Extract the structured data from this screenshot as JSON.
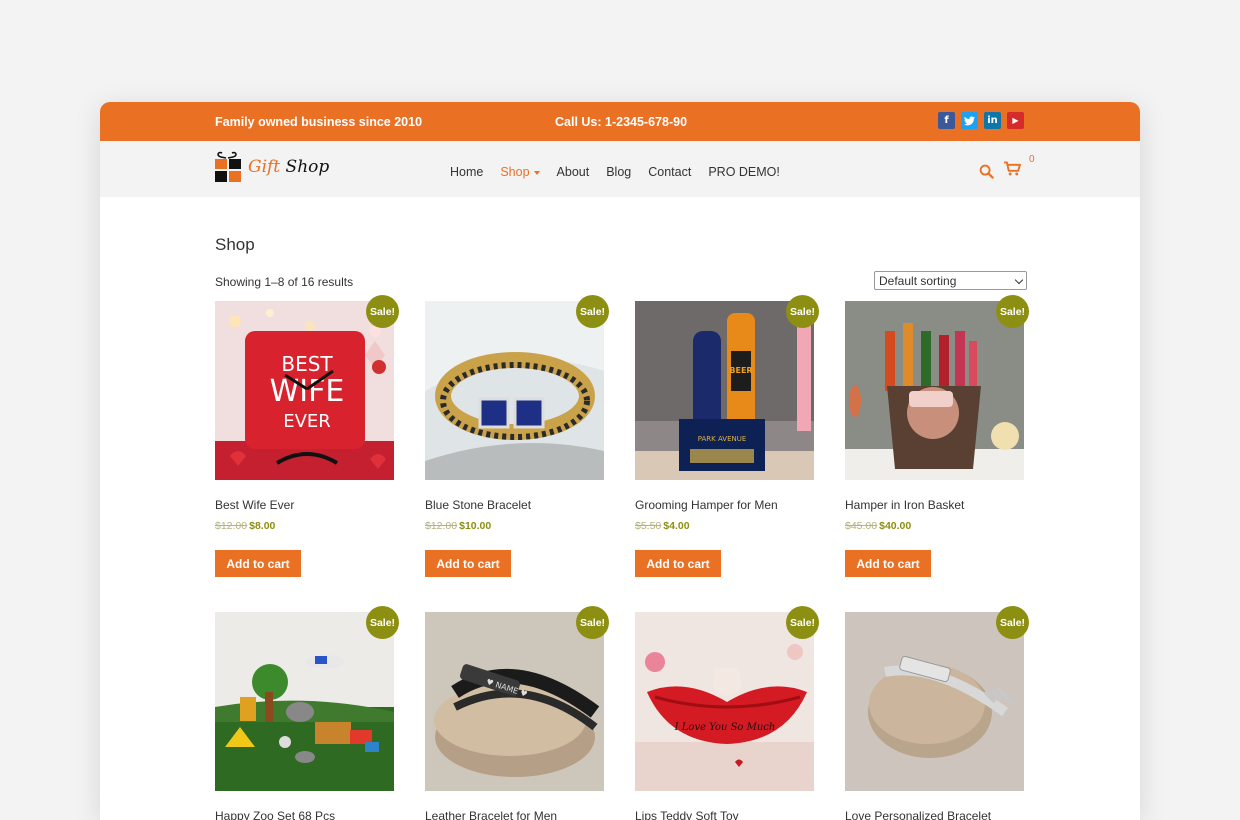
{
  "topbar": {
    "tagline": "Family owned business since 2010",
    "phone": "Call Us: 1-2345-678-90",
    "socials": [
      {
        "icon": "facebook-icon",
        "glyph": "f",
        "color": "#3b5998"
      },
      {
        "icon": "twitter-icon",
        "glyph": "t",
        "color": "#1da1f2"
      },
      {
        "icon": "linkedin-icon",
        "glyph": "in",
        "color": "#0e76a8"
      },
      {
        "icon": "youtube-icon",
        "glyph": "▶",
        "color": "#d62b2b"
      }
    ]
  },
  "header": {
    "logo_gift": "Gift",
    "logo_shop": "Shop",
    "nav": [
      "Home",
      "Shop",
      "About",
      "Blog",
      "Contact",
      "PRO DEMO!"
    ],
    "cart_count": "0"
  },
  "main": {
    "title": "Shop",
    "result_count": "Showing 1–8 of 16 results",
    "sort_selected": "Default sorting"
  },
  "products": [
    {
      "name": "Best Wife Ever",
      "old_price": "$12.00",
      "new_price": "$8.00",
      "sale": "Sale!",
      "button": "Add to cart",
      "image": "clock"
    },
    {
      "name": "Blue Stone Bracelet",
      "old_price": "$12.00",
      "new_price": "$10.00",
      "sale": "Sale!",
      "button": "Add to cart",
      "image": "bracelet"
    },
    {
      "name": "Grooming Hamper for Men",
      "old_price": "$5.50",
      "new_price": "$4.00",
      "sale": "Sale!",
      "button": "Add to cart",
      "image": "hamper"
    },
    {
      "name": "Hamper in Iron Basket",
      "old_price": "$45.00",
      "new_price": "$40.00",
      "sale": "Sale!",
      "button": "Add to cart",
      "image": "basket"
    },
    {
      "name": "Happy Zoo Set 68 Pcs",
      "sale": "Sale!",
      "image": "zoo"
    },
    {
      "name": "Leather Bracelet for Men",
      "sale": "Sale!",
      "image": "leather"
    },
    {
      "name": "Lips Teddy Soft Toy",
      "sale": "Sale!",
      "image": "lips"
    },
    {
      "name": "Love Personalized Bracelet",
      "sale": "Sale!",
      "image": "personal"
    }
  ],
  "colors": {
    "accent": "#ea7024",
    "sale": "#8d8f12"
  }
}
